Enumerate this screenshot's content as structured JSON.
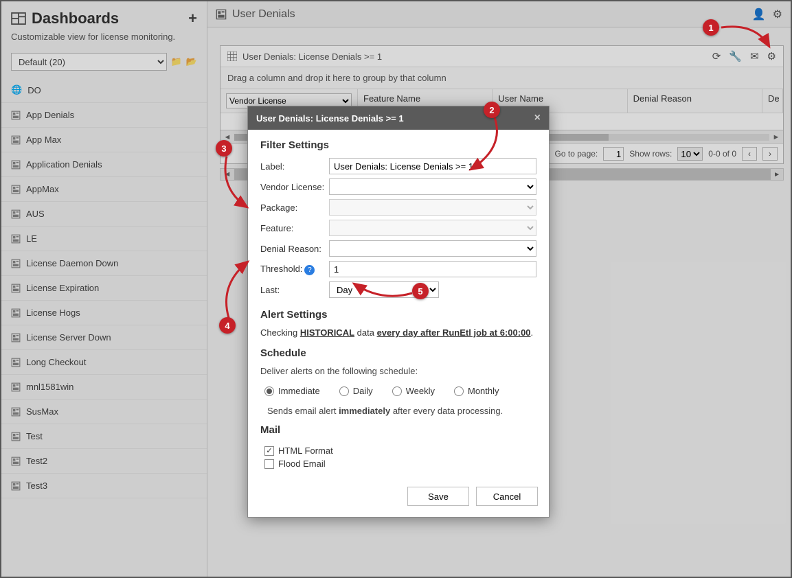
{
  "sidebar": {
    "title": "Dashboards",
    "subtitle": "Customizable view for license monitoring.",
    "selector": "Default (20)",
    "items": [
      {
        "label": "DO",
        "icon": "globe"
      },
      {
        "label": "App Denials",
        "icon": "dash"
      },
      {
        "label": "App Max",
        "icon": "dash"
      },
      {
        "label": "Application Denials",
        "icon": "dash"
      },
      {
        "label": "AppMax",
        "icon": "dash"
      },
      {
        "label": "AUS",
        "icon": "dash"
      },
      {
        "label": "LE",
        "icon": "dash"
      },
      {
        "label": "License Daemon Down",
        "icon": "dash"
      },
      {
        "label": "License Expiration",
        "icon": "dash"
      },
      {
        "label": "License Hogs",
        "icon": "dash"
      },
      {
        "label": "License Server Down",
        "icon": "dash"
      },
      {
        "label": "Long Checkout",
        "icon": "dash"
      },
      {
        "label": "mnl1581win",
        "icon": "dash"
      },
      {
        "label": "SusMax",
        "icon": "dash"
      },
      {
        "label": "Test",
        "icon": "dash"
      },
      {
        "label": "Test2",
        "icon": "dash"
      },
      {
        "label": "Test3",
        "icon": "dash"
      }
    ]
  },
  "main": {
    "title": "User Denials",
    "panel_title": "User Denials: License Denials >= 1",
    "group_hint": "Drag a column and drop it here to group by that column",
    "columns": [
      "Vendor License",
      "Feature Name",
      "User Name",
      "Denial Reason",
      "De"
    ],
    "pager": {
      "goto_label": "Go to page:",
      "page": "1",
      "showrows_label": "Show rows:",
      "rows": "10",
      "range": "0-0 of 0"
    }
  },
  "modal": {
    "title": "User Denials: License Denials >= 1",
    "filter_heading": "Filter Settings",
    "labels": {
      "label": "Label:",
      "vendor": "Vendor License:",
      "package": "Package:",
      "feature": "Feature:",
      "denial": "Denial Reason:",
      "threshold": "Threshold:",
      "last": "Last:"
    },
    "values": {
      "label": "User Denials: License Denials >= 1",
      "threshold": "1",
      "last": "Day"
    },
    "alert_heading": "Alert Settings",
    "alert_text_pre": "Checking ",
    "alert_text_hist": "HISTORICAL",
    "alert_text_mid": " data ",
    "alert_text_sched": "every day after RunEtl job at 6:00:00",
    "alert_text_end": ".",
    "schedule_heading": "Schedule",
    "schedule_text": "Deliver alerts on the following schedule:",
    "radios": [
      "Immediate",
      "Daily",
      "Weekly",
      "Monthly"
    ],
    "radio_selected": "Immediate",
    "schedule_note_pre": "Sends email alert ",
    "schedule_note_bold": "immediately",
    "schedule_note_post": " after every data processing.",
    "mail_heading": "Mail",
    "mail_html": "HTML Format",
    "mail_flood": "Flood Email",
    "save": "Save",
    "cancel": "Cancel"
  },
  "callouts": {
    "1": "1",
    "2": "2",
    "3": "3",
    "4": "4",
    "5": "5"
  }
}
